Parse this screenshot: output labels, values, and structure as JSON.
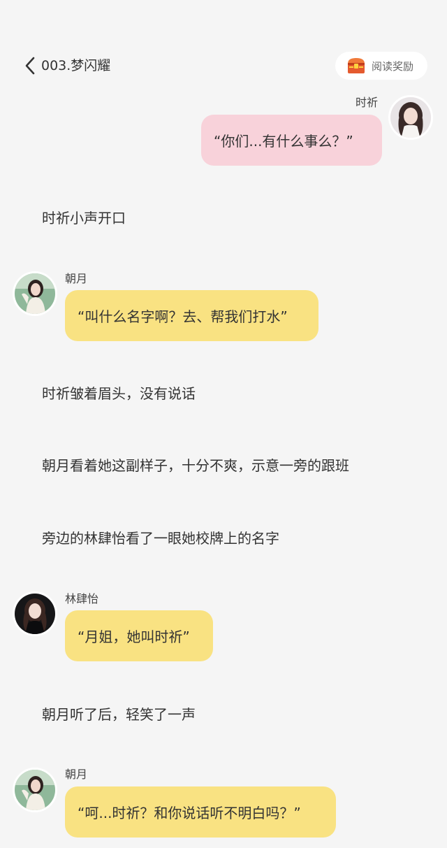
{
  "header": {
    "title": "003.梦闪耀",
    "reward_label": "阅读奖励"
  },
  "messages": [
    {
      "speaker": "时祈",
      "text": "“你们...有什么事么？”"
    },
    {
      "speaker": "朝月",
      "text": "“叫什么名字啊？去、帮我们打水”"
    },
    {
      "speaker": "林肆怡",
      "text": "“月姐，她叫时祈”"
    },
    {
      "speaker": "朝月",
      "text": "“呵...时祈？和你说话听不明白吗？”"
    }
  ],
  "narration": [
    "时祈小声开口",
    "时祈皱着眉头，没有说话",
    "朝月看着她这副样子，十分不爽，示意一旁的跟班",
    "旁边的林肆怡看了一眼她校牌上的名字",
    "朝月听了后，轻笑了一声"
  ],
  "colors": {
    "background": "#f5f5f5",
    "bubble_pink": "#f8d2da",
    "bubble_yellow": "#f9e282"
  },
  "icons": {
    "back": "chevron-left-icon",
    "reward": "treasure-chest-icon"
  }
}
